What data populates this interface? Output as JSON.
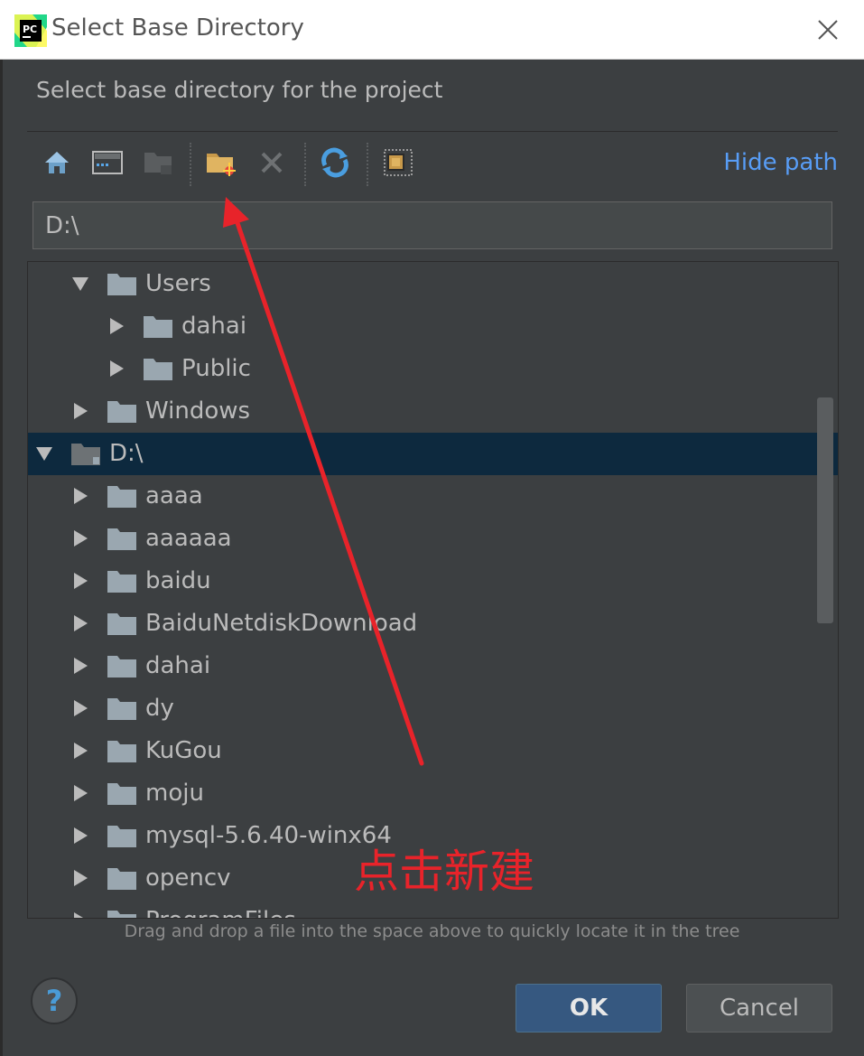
{
  "window": {
    "title": "Select Base Directory",
    "logo_text": "PC"
  },
  "dialog": {
    "description": "Select base directory for the project",
    "hide_path_label": "Hide path",
    "path_value": "D:\\",
    "hint": "Drag and drop a file into the space above to quickly locate it in the tree",
    "ok_label": "OK",
    "cancel_label": "Cancel",
    "help_label": "?"
  },
  "toolbar": {
    "icons": [
      "home-icon",
      "desktop-icon",
      "project-folder-icon",
      "new-folder-icon",
      "delete-icon",
      "refresh-icon",
      "show-hidden-icon"
    ]
  },
  "tree": {
    "rows": [
      {
        "label": "Users",
        "expanded": true,
        "level": 1
      },
      {
        "label": "dahai",
        "expanded": false,
        "level": 2
      },
      {
        "label": "Public",
        "expanded": false,
        "level": 2
      },
      {
        "label": "Windows",
        "expanded": false,
        "level": 1
      },
      {
        "label": "D:\\",
        "expanded": true,
        "level": 0,
        "selected": true
      },
      {
        "label": "aaaa",
        "expanded": false,
        "level": 1
      },
      {
        "label": "aaaaaa",
        "expanded": false,
        "level": 1
      },
      {
        "label": "baidu",
        "expanded": false,
        "level": 1
      },
      {
        "label": "BaiduNetdiskDownload",
        "expanded": false,
        "level": 1
      },
      {
        "label": "dahai",
        "expanded": false,
        "level": 1
      },
      {
        "label": "dy",
        "expanded": false,
        "level": 1
      },
      {
        "label": "KuGou",
        "expanded": false,
        "level": 1
      },
      {
        "label": "moju",
        "expanded": false,
        "level": 1
      },
      {
        "label": "mysql-5.6.40-winx64",
        "expanded": false,
        "level": 1
      },
      {
        "label": "opencv",
        "expanded": false,
        "level": 1
      },
      {
        "label": "ProgramFiles",
        "expanded": false,
        "level": 1
      }
    ]
  },
  "annotation": {
    "text": "点击新建",
    "color": "#e8232a"
  },
  "colors": {
    "background": "#3c3f41",
    "selection": "#0d293e",
    "link": "#589df6",
    "primary_button": "#365880"
  }
}
